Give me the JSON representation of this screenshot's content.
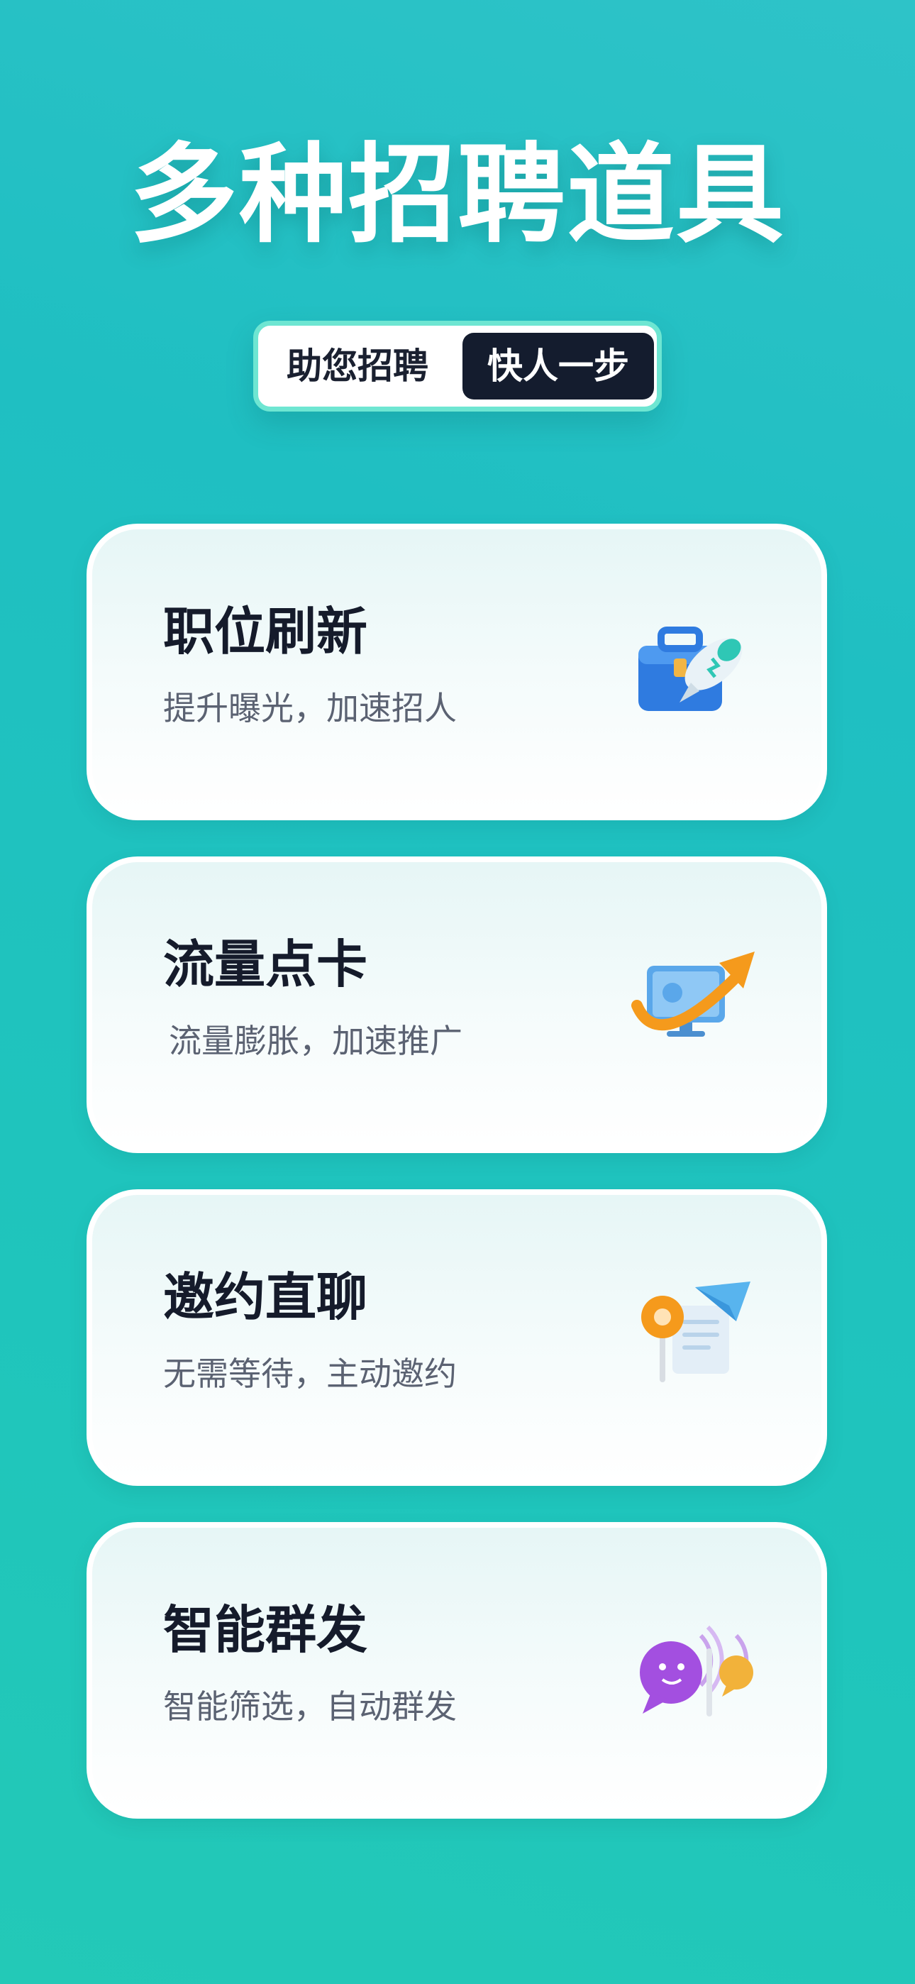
{
  "header": {
    "title": "多种招聘道具",
    "pill_left": "助您招聘",
    "pill_right": "快人一步"
  },
  "cards": [
    {
      "title": "职位刷新",
      "subtitle": "提升曝光，加速招人",
      "icon": "briefcase-rocket-icon"
    },
    {
      "title": "流量点卡",
      "subtitle": "流量膨胀，加速推广",
      "icon": "monitor-growth-arrow-icon"
    },
    {
      "title": "邀约直聊",
      "subtitle": "无需等待，主动邀约",
      "icon": "pin-paper-plane-icon"
    },
    {
      "title": "智能群发",
      "subtitle": "智能筛选，自动群发",
      "icon": "chat-bubbles-broadcast-icon"
    }
  ],
  "colors": {
    "background": "#1fc2bf",
    "card": "#f4fbfb",
    "title_text": "#151b2b",
    "sub_text": "#5b6272",
    "pill_dark": "#141c2e",
    "pill_border": "#6ee6d2"
  }
}
